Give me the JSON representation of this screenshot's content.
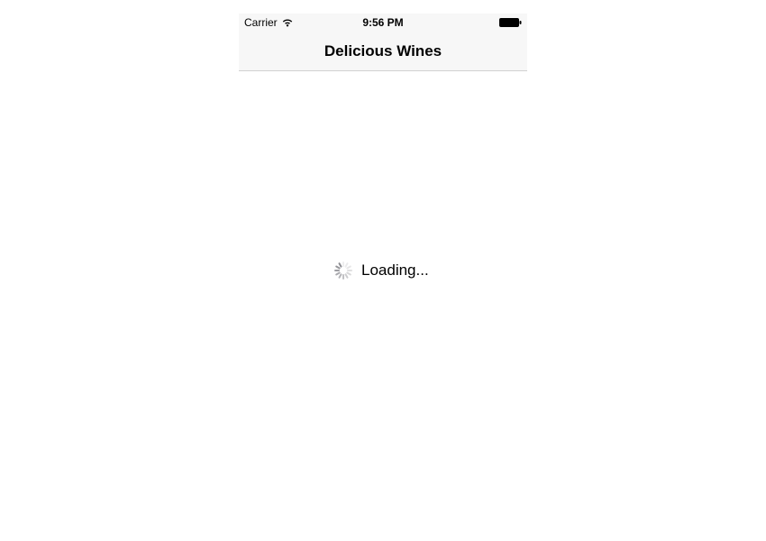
{
  "statusBar": {
    "carrier": "Carrier",
    "time": "9:56 PM"
  },
  "navBar": {
    "title": "Delicious Wines"
  },
  "content": {
    "loadingText": "Loading..."
  }
}
